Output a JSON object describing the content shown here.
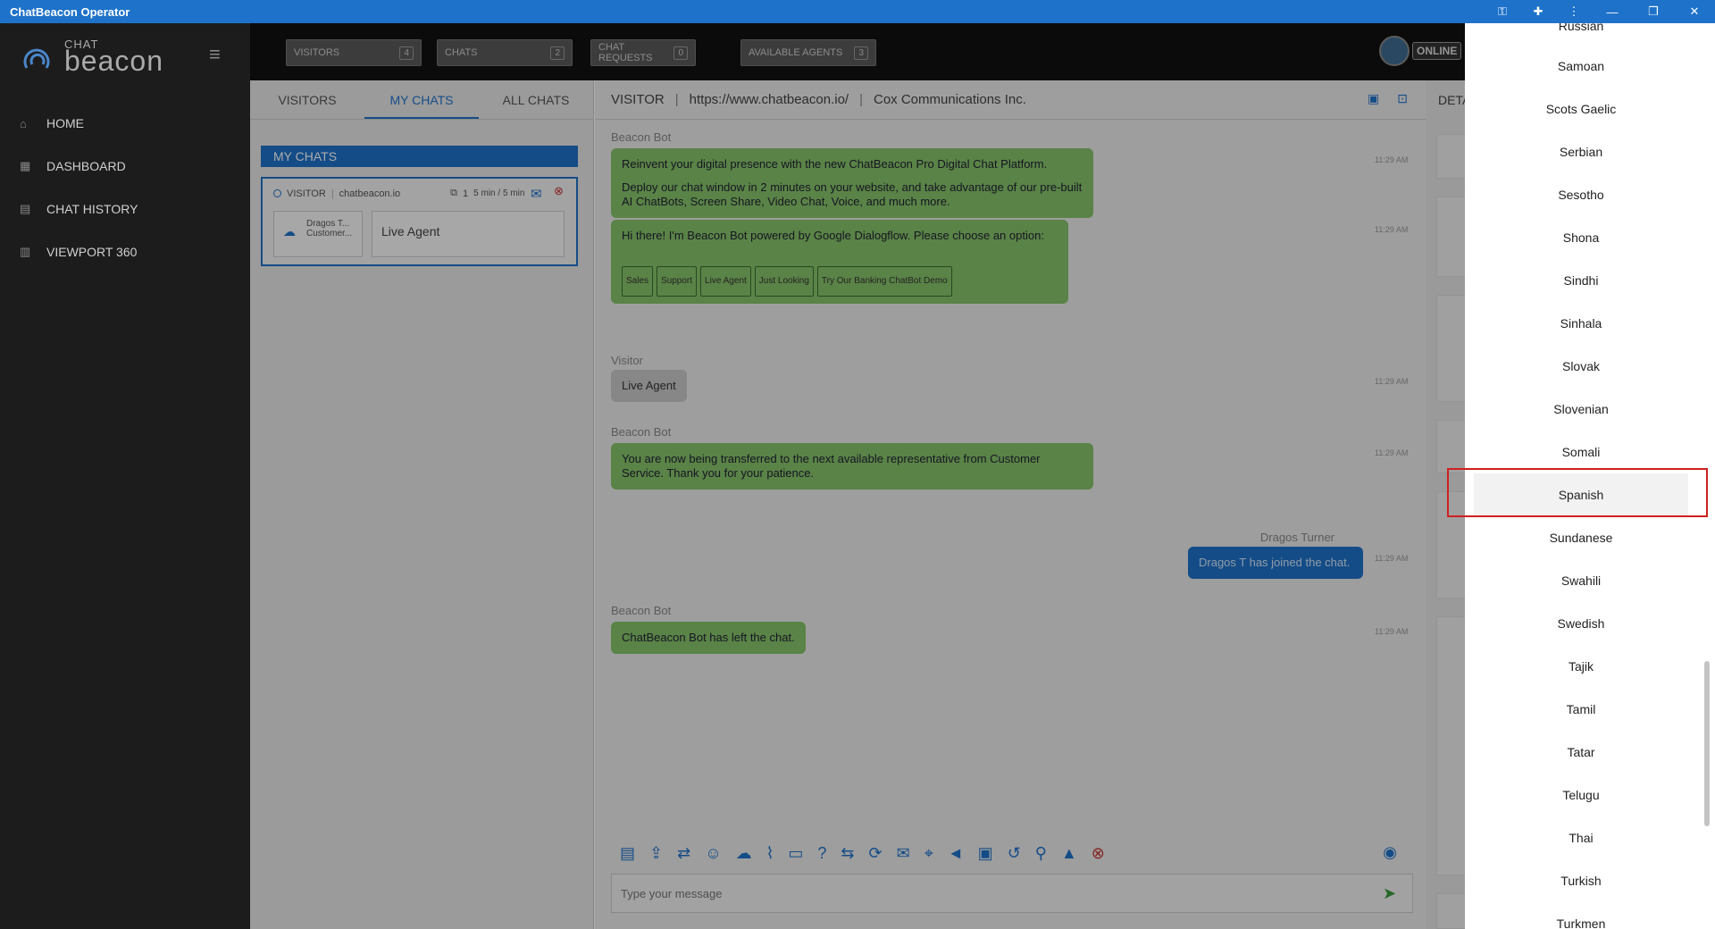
{
  "window": {
    "title": "ChatBeacon Operator",
    "icons": [
      "key-icon",
      "puzzle-icon",
      "more-vert-icon"
    ],
    "controls": [
      "minimize",
      "restore",
      "close"
    ]
  },
  "brand": {
    "chat": "CHAT",
    "beacon": "beacon"
  },
  "sidebar": {
    "items": [
      {
        "label": "HOME",
        "icon": "home-icon"
      },
      {
        "label": "DASHBOARD",
        "icon": "dashboard-icon"
      },
      {
        "label": "CHAT HISTORY",
        "icon": "history-icon"
      },
      {
        "label": "VIEWPORT 360",
        "icon": "chart-icon"
      }
    ]
  },
  "topbar": {
    "pills": [
      {
        "label": "VISITORS",
        "count": "4"
      },
      {
        "label": "CHATS",
        "count": "2"
      },
      {
        "label": "CHAT REQUESTS",
        "count": "0"
      },
      {
        "label": "AVAILABLE AGENTS",
        "count": "3"
      }
    ],
    "status": "ONLINE"
  },
  "left_tabs": [
    {
      "label": "VISITORS"
    },
    {
      "label": "MY CHATS",
      "active": true
    },
    {
      "label": "ALL CHATS"
    }
  ],
  "my_chats": {
    "header": "MY CHATS",
    "card": {
      "type": "VISITOR",
      "site": "chatbeacon.io",
      "count": "1",
      "time": "5 min / 5 min",
      "agent_line1": "Dragos T...",
      "agent_line2": "Customer...",
      "last_message": "Live Agent"
    }
  },
  "chat_header": {
    "label": "VISITOR",
    "url": "https://www.chatbeacon.io/",
    "company": "Cox Communications Inc."
  },
  "messages": {
    "m1": {
      "sender": "Beacon Bot",
      "line1": "Reinvent your digital presence with the new ChatBeacon Pro Digital Chat Platform.",
      "line2": "Deploy our chat window in 2 minutes on your website, and take advantage of our pre-built AI ChatBots, Screen Share, Video Chat, Voice, and much more.",
      "time": "11:29 AM"
    },
    "m2": {
      "text": "Hi there! I'm Beacon Bot powered by Google Dialogflow. Please choose an option:",
      "time": "11:29 AM",
      "options": [
        "Sales",
        "Support",
        "Live Agent",
        "Just Looking",
        "Try Our Banking ChatBot Demo"
      ]
    },
    "m3": {
      "sender": "Visitor",
      "text": "Live Agent",
      "time": "11:29 AM"
    },
    "m4": {
      "sender": "Beacon Bot",
      "text": "You are now being transferred to the next available representative from Customer Service. Thank you for your patience.",
      "time": "11:29 AM"
    },
    "m5": {
      "sender": "Dragos Turner",
      "text": "Dragos T has joined the chat.",
      "time": "11:29 AM"
    },
    "m6": {
      "sender": "Beacon Bot",
      "text": "ChatBeacon Bot has left the chat.",
      "time": "11:29 AM"
    }
  },
  "composer": {
    "placeholder": "Type your message"
  },
  "details": {
    "header": "DETA"
  },
  "languages": {
    "partial_top": "Russian",
    "items": [
      "Samoan",
      "Scots Gaelic",
      "Serbian",
      "Sesotho",
      "Shona",
      "Sindhi",
      "Sinhala",
      "Slovak",
      "Slovenian",
      "Somali",
      "Spanish",
      "Sundanese",
      "Swahili",
      "Swedish",
      "Tajik",
      "Tamil",
      "Tatar",
      "Telugu",
      "Thai",
      "Turkish",
      "Turkmen"
    ],
    "highlighted": "Spanish"
  },
  "colors": {
    "accent": "#1e72c9",
    "bot_bubble": "#86c46a",
    "highlight_border": "#d02020"
  }
}
